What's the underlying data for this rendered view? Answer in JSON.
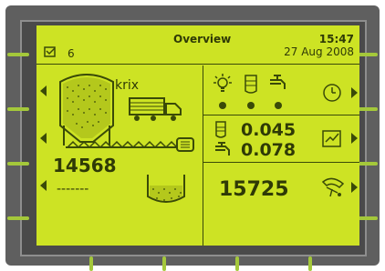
{
  "header": {
    "title": "Overview",
    "time": "15:47",
    "date": "27 Aug 2008",
    "message_count": "6"
  },
  "silo": {
    "name": "krix",
    "quantity": "14568"
  },
  "output": {
    "value": "-------"
  },
  "flow": {
    "value1": "0.045",
    "value2": "0.078"
  },
  "total": {
    "value": "15725"
  },
  "icons": [
    "mail-icon",
    "silo-icon",
    "truck-icon",
    "conveyor-icon",
    "hopper-icon",
    "light-icon",
    "tank-icon",
    "tap-icon",
    "clock-icon",
    "chart-icon",
    "hand-icon"
  ]
}
